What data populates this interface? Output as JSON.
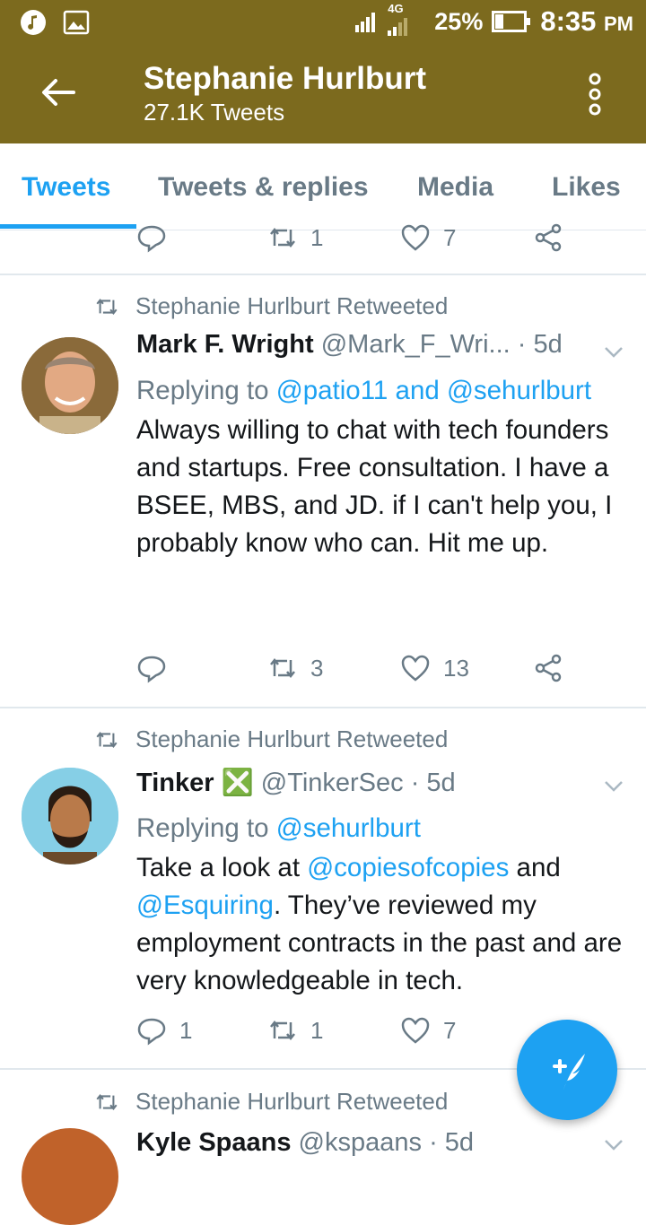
{
  "status_bar": {
    "network": "4G",
    "battery": "25%",
    "time": "8:35",
    "ampm": "PM"
  },
  "app_bar": {
    "title": "Stephanie Hurlburt",
    "subtitle": "27.1K Tweets"
  },
  "tabs": [
    {
      "label": "Tweets",
      "active": true
    },
    {
      "label": "Tweets & replies",
      "active": false
    },
    {
      "label": "Media",
      "active": false
    },
    {
      "label": "Likes",
      "active": false
    }
  ],
  "prev_tweet_actions": {
    "retweets": "1",
    "likes": "7"
  },
  "tweets": [
    {
      "retweeted_by": "Stephanie Hurlburt Retweeted",
      "name": "Mark F. Wright",
      "handle": "@Mark_F_Wri...",
      "time": "· 5d",
      "replying_prefix": "Replying to",
      "replying_to": "@patio11 and @sehurlburt",
      "text": "Always willing to chat with tech founders and startups. Free consultation. I have a BSEE, MBS, and JD. if I can't help you, I probably know who can. Hit me up.",
      "replies": "",
      "retweets": "3",
      "likes": "13"
    },
    {
      "retweeted_by": "Stephanie Hurlburt Retweeted",
      "name": "Tinker",
      "badge": "❎",
      "handle": "@TinkerSec",
      "time": "· 5d",
      "replying_prefix": "Replying to",
      "replying_to": "@sehurlburt",
      "text_1": "Take a look at",
      "mention_1": "@copiesofcopies",
      "text_2": "and",
      "mention_2": "@Esquiring",
      "text_3": ". They’ve reviewed my employment contracts in the past and are very knowledgeable in tech.",
      "replies": "1",
      "retweets": "1",
      "likes": "7"
    },
    {
      "retweeted_by": "Stephanie Hurlburt Retweeted",
      "name": "Kyle Spaans",
      "handle": "@kspaans",
      "time": "· 5d"
    }
  ],
  "colors": {
    "app_bar": "#7c6a1e",
    "accent": "#1da1f2",
    "secondary_text": "#697a86",
    "primary_text": "#14171a"
  },
  "icons": [
    "music-icon",
    "image-icon",
    "signal-icon",
    "battery-icon",
    "back-arrow-icon",
    "more-vert-icon",
    "reply-icon",
    "retweet-icon",
    "heart-icon",
    "share-icon",
    "chevron-down-icon",
    "compose-icon"
  ]
}
